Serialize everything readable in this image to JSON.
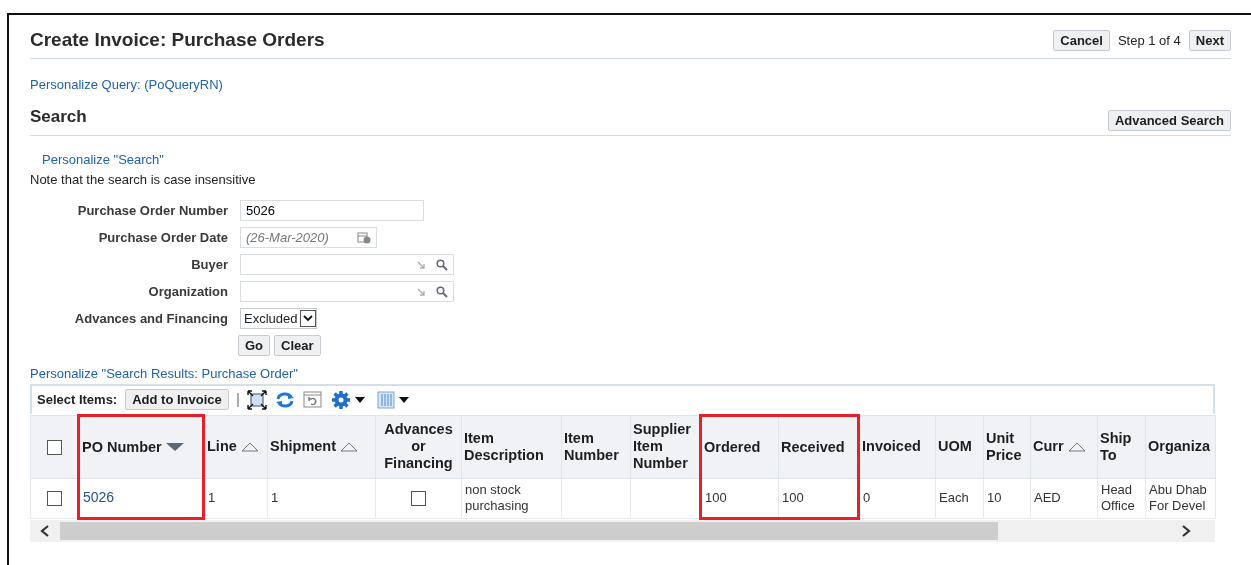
{
  "header": {
    "title": "Create Invoice: Purchase Orders",
    "cancel_button": "Cancel",
    "step_text": "Step 1 of 4",
    "next_button": "Next"
  },
  "personalize_query_link": "Personalize Query: (PoQueryRN)",
  "search": {
    "title": "Search",
    "advanced_search_button": "Advanced Search",
    "personalize_link": "Personalize \"Search\"",
    "note": "Note that the search is case insensitive",
    "fields": [
      {
        "label": "Purchase Order Number",
        "kind": "text",
        "value": "5026"
      },
      {
        "label": "Purchase Order Date",
        "kind": "date",
        "placeholder": "(26-Mar-2020)"
      },
      {
        "label": "Buyer",
        "kind": "lov"
      },
      {
        "label": "Organization",
        "kind": "lov"
      },
      {
        "label": "Advances and Financing",
        "kind": "select",
        "value": "Excluded"
      }
    ],
    "buttons": [
      "Go",
      "Clear"
    ]
  },
  "results": {
    "personalize_link": "Personalize \"Search Results: Purchase Order\"",
    "select_label": "Select Items:",
    "add_button": "Add to Invoice",
    "table": {
      "select_all_checked": false,
      "columns": [
        {
          "label": "PO Number",
          "sorted": true,
          "highlighted": true
        },
        {
          "label": "Line",
          "sorted": false,
          "highlighted": false
        },
        {
          "label": "Shipment",
          "sorted": false,
          "highlighted": false
        },
        {
          "label": "Advances or Financing",
          "highlighted": false
        },
        {
          "label": "Item Description",
          "highlighted": false
        },
        {
          "label": "Item Number",
          "highlighted": false
        },
        {
          "label": "Supplier Item Number",
          "highlighted": false
        },
        {
          "label": "Ordered",
          "highlighted": true
        },
        {
          "label": "Received",
          "highlighted": true
        },
        {
          "label": "Invoiced",
          "highlighted": false
        },
        {
          "label": "UOM",
          "highlighted": false
        },
        {
          "label": "Unit Price",
          "highlighted": false
        },
        {
          "label": "Curr",
          "sorted": false,
          "highlighted": false
        },
        {
          "label": "Ship To",
          "highlighted": false
        },
        {
          "label": "Organiza",
          "highlighted": false
        }
      ],
      "rows": [
        {
          "selected": false,
          "cells": [
            {
              "kind": "link",
              "text": "5026"
            },
            {
              "kind": "text",
              "text": "1"
            },
            {
              "kind": "text",
              "text": "1"
            },
            {
              "kind": "checkbox",
              "checked": false
            },
            {
              "kind": "text",
              "text": "non stock purchasing"
            },
            {
              "kind": "empty"
            },
            {
              "kind": "empty"
            },
            {
              "kind": "text",
              "text": "100"
            },
            {
              "kind": "text",
              "text": "100"
            },
            {
              "kind": "text",
              "text": "0"
            },
            {
              "kind": "text",
              "text": "Each"
            },
            {
              "kind": "text",
              "text": "10"
            },
            {
              "kind": "text",
              "text": "AED"
            },
            {
              "kind": "text",
              "text": "Head Office"
            },
            {
              "kind": "text",
              "text": "Abu Dhab For Devel"
            }
          ]
        }
      ]
    }
  }
}
